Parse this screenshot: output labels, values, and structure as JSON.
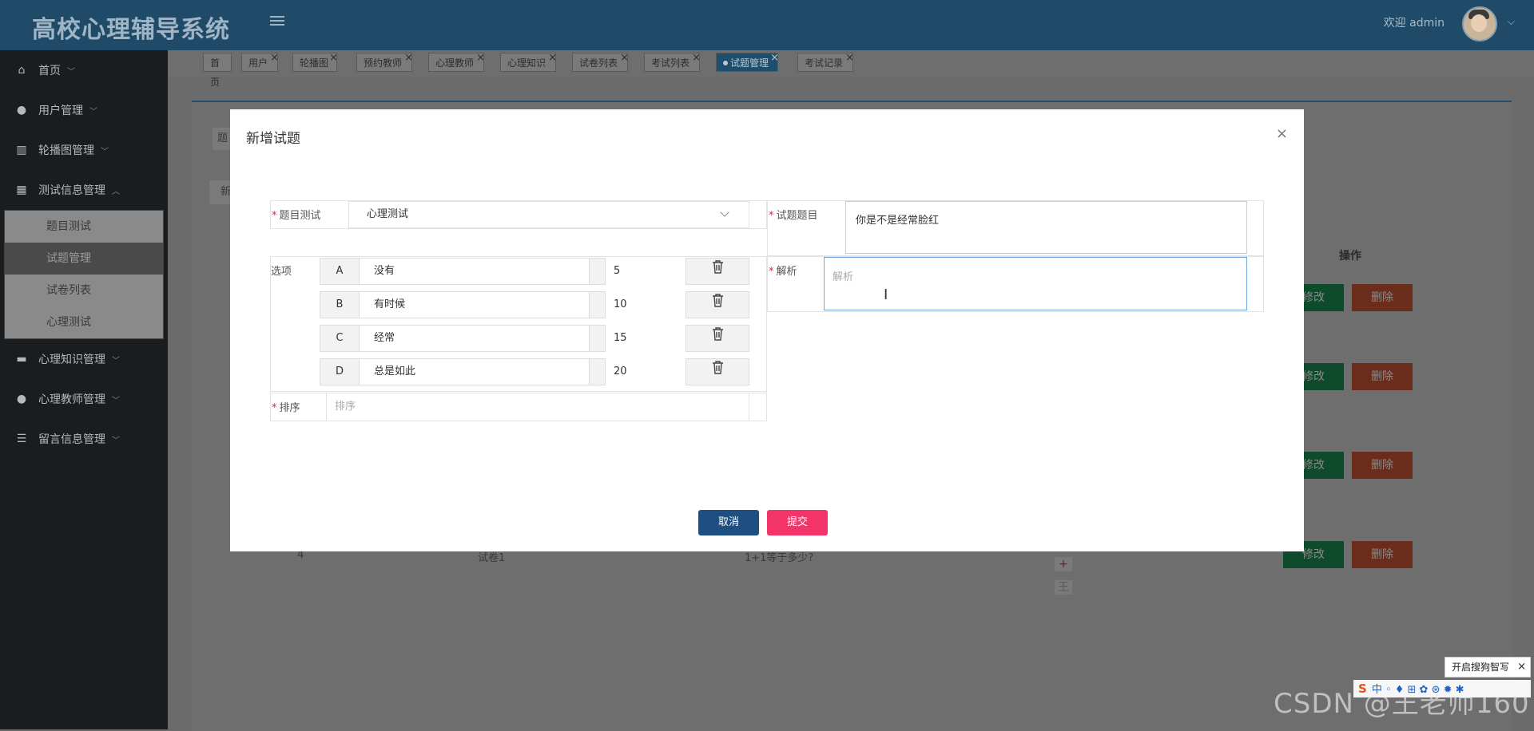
{
  "header": {
    "app_title": "高校心理辅导系统",
    "welcome": "欢迎 admin"
  },
  "sidebar": {
    "items": [
      {
        "label": "首页",
        "icon": "home-icon"
      },
      {
        "label": "用户管理",
        "icon": "user-icon"
      },
      {
        "label": "轮播图管理",
        "icon": "carousel-icon"
      },
      {
        "label": "测试信息管理",
        "icon": "grid-icon",
        "expanded": true
      },
      {
        "label": "心理知识管理",
        "icon": "book-icon"
      },
      {
        "label": "心理教师管理",
        "icon": "user-icon"
      },
      {
        "label": "留言信息管理",
        "icon": "list-icon"
      }
    ],
    "subitems": [
      {
        "label": "题目测试"
      },
      {
        "label": "试题管理",
        "active": true
      },
      {
        "label": "试卷列表"
      },
      {
        "label": "心理测试"
      }
    ]
  },
  "tabs": [
    {
      "label": "首页"
    },
    {
      "label": "用户"
    },
    {
      "label": "轮播图"
    },
    {
      "label": "预约教师"
    },
    {
      "label": "心理教师"
    },
    {
      "label": "心理知识"
    },
    {
      "label": "试卷列表"
    },
    {
      "label": "考试列表"
    },
    {
      "label": "试题管理",
      "active": true
    },
    {
      "label": "考试记录"
    }
  ],
  "background": {
    "op_header": "操作",
    "edit_label": "修改",
    "delete_label": "删除",
    "row4": {
      "id": "4",
      "paper": "试卷1",
      "question": "1+1等于多少?"
    },
    "plus": "+",
    "minus": "王",
    "new_button": "新",
    "search_placeholder": "题"
  },
  "modal": {
    "title": "新增试题",
    "form": {
      "test_label": "题目测试",
      "test_value": "心理测试",
      "question_label": "试题题目",
      "question_value": "你是不是经常脸红",
      "options_label": "选项",
      "options": [
        {
          "letter": "A",
          "text": "没有",
          "score": "5"
        },
        {
          "letter": "B",
          "text": "有时候",
          "score": "10"
        },
        {
          "letter": "C",
          "text": "经常",
          "score": "15"
        },
        {
          "letter": "D",
          "text": "总是如此",
          "score": "20"
        }
      ],
      "analysis_label": "解析",
      "analysis_placeholder": "解析",
      "order_label": "排序",
      "order_placeholder": "排序"
    },
    "cancel_label": "取消",
    "submit_label": "提交"
  },
  "ime": {
    "popup": "开启搜狗智写",
    "bar_logo": "S",
    "bar_text": "中 ◦ ♦ ⊞ ✿ ⊛ ✹ ✱"
  },
  "watermark": "CSDN @王老师160",
  "colors": {
    "header": "#1f4a68",
    "sidebar": "#1a1d20",
    "cancel": "#1f4e80",
    "submit": "#f2346a",
    "required": "#e23"
  }
}
